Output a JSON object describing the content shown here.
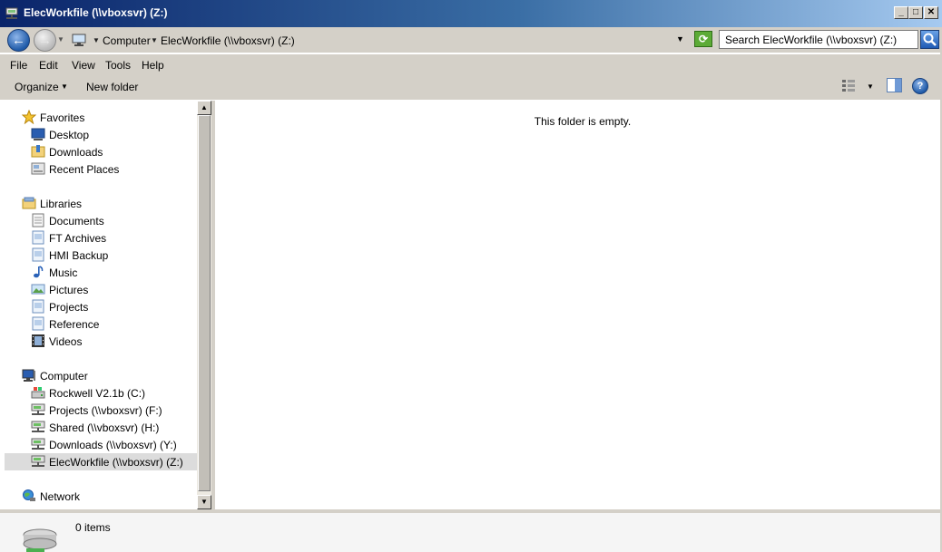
{
  "window": {
    "title": "ElecWorkfile (\\\\vboxsvr) (Z:)",
    "minimize": "_",
    "maximize": "□",
    "close": "✕"
  },
  "address": {
    "breadcrumbs": [
      "Computer",
      "ElecWorkfile (\\\\vboxsvr) (Z:)"
    ],
    "refresh": "⟳"
  },
  "search": {
    "placeholder": "Search ElecWorkfile (\\\\vboxsvr) (Z:)"
  },
  "menu": [
    "File",
    "Edit",
    "View",
    "Tools",
    "Help"
  ],
  "toolbar": {
    "organize": "Organize",
    "new_folder": "New folder",
    "help": "?"
  },
  "nav": {
    "favorites": {
      "label": "Favorites",
      "items": [
        "Desktop",
        "Downloads",
        "Recent Places"
      ]
    },
    "libraries": {
      "label": "Libraries",
      "items": [
        "Documents",
        "FT Archives",
        "HMI Backup",
        "Music",
        "Pictures",
        "Projects",
        "Reference",
        "Videos"
      ]
    },
    "computer": {
      "label": "Computer",
      "items": [
        "Rockwell V2.1b (C:)",
        "Projects (\\\\vboxsvr) (F:)",
        "Shared (\\\\vboxsvr) (H:)",
        "Downloads (\\\\vboxsvr) (Y:)",
        "ElecWorkfile (\\\\vboxsvr) (Z:)"
      ],
      "selected_index": 4
    },
    "network": {
      "label": "Network"
    }
  },
  "content": {
    "empty_message": "This folder is empty."
  },
  "details": {
    "item_count": "0 items"
  },
  "colors": {
    "title_start": "#0a246a",
    "title_end": "#a6caf0",
    "chrome": "#d4d0c8",
    "selected": "#dcdcdc"
  }
}
